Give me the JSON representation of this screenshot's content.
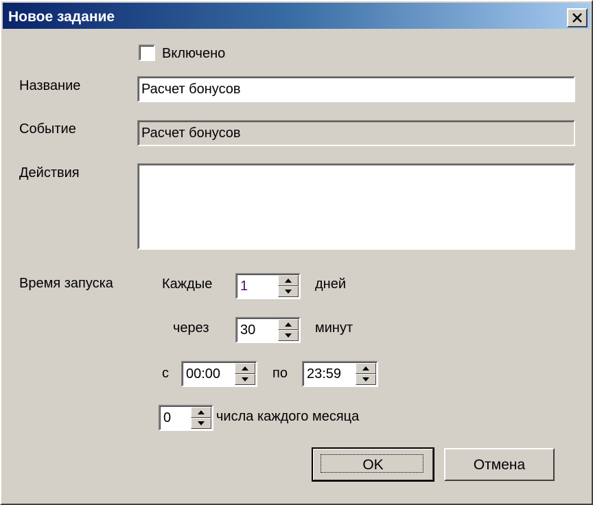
{
  "window": {
    "title": "Новое задание"
  },
  "enabled": {
    "label": "Включено",
    "checked": false
  },
  "name": {
    "label": "Название",
    "value": "Расчет бонусов"
  },
  "event": {
    "label": "Событие",
    "value": "Расчет бонусов"
  },
  "actions": {
    "label": "Действия",
    "value": ""
  },
  "schedule": {
    "label": "Время запуска",
    "every_label": "Каждые",
    "every_value": "1",
    "days_label": "дней",
    "through_label": "через",
    "through_value": "30",
    "minutes_label": "минут",
    "from_label": "с",
    "from_value": "00:00",
    "to_label": "по",
    "to_value": "23:59",
    "day_value": "0",
    "day_label": "числа каждого месяца"
  },
  "buttons": {
    "ok": "OK",
    "cancel": "Отмена"
  },
  "icons": {
    "close": "close-icon",
    "spin_up": "arrow-up-icon",
    "spin_down": "arrow-down-icon"
  },
  "colors": {
    "face": "#d4d0c8",
    "title_start": "#0a246a",
    "title_end": "#a6caf0"
  }
}
